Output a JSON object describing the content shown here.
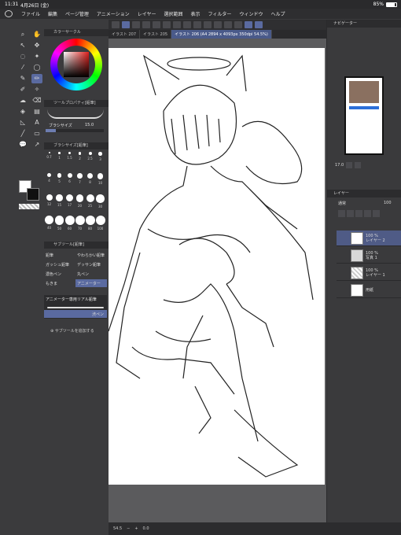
{
  "status": {
    "time": "11:31",
    "date": "4月26日 (金)",
    "battery": "85%"
  },
  "menu": [
    "ファイル",
    "編集",
    "ページ管理",
    "アニメーション",
    "レイヤー",
    "選択範囲",
    "表示",
    "フィルター",
    "ウィンドウ",
    "ヘルプ"
  ],
  "tabs": [
    "イラスト 207",
    "イラスト 205",
    "イラスト 206 (A4 2894 x 4093px 350dpi 54.5%)"
  ],
  "left": {
    "color_circle_title": "カラーサークル",
    "tool_property_title": "ツールプロパティ[鉛筆]",
    "brush_size_label": "ブラシサイズ",
    "brush_size_value": "15.0",
    "brush_size_title": "ブラシサイズ[鉛筆]",
    "size_values": [
      "0.7",
      "1",
      "1.5",
      "2",
      "2.5",
      "3",
      "4",
      "5",
      "6",
      "7",
      "8",
      "10",
      "12",
      "15",
      "17",
      "20",
      "25",
      "30",
      "40",
      "50",
      "60",
      "70",
      "80",
      "100"
    ],
    "subtool_title": "サブツール[鉛筆]",
    "subtools": [
      "鉛筆",
      "やわらかい鉛筆",
      "ガッシュ鉛筆",
      "デッサン鉛筆",
      "濃色ペン",
      "丸ペン",
      "もきま",
      "アニメーター"
    ],
    "subtool_banner": "アニメーター専用リアル鉛筆",
    "subtool_bottom": "渋ペン",
    "add_subtool": "サブツールを追加する"
  },
  "right": {
    "navigator_title": "ナビゲーター",
    "zoom_value": "17.0",
    "layers_title": "レイヤー",
    "blend_mode": "通常",
    "opacity": "100",
    "layers": [
      {
        "name": "100 %\nレイヤー 2",
        "selected": true
      },
      {
        "name": "100 %\n写真 1",
        "selected": false
      },
      {
        "name": "100 %\nレイヤー 1",
        "selected": false
      },
      {
        "name": "用紙",
        "selected": false
      }
    ]
  },
  "bottom": {
    "zoom": "54.5",
    "angle": "0.0"
  },
  "colors": {
    "accent": "#5a6aa0",
    "panel": "#3b3b3d",
    "bar": "#2c2c2e"
  }
}
